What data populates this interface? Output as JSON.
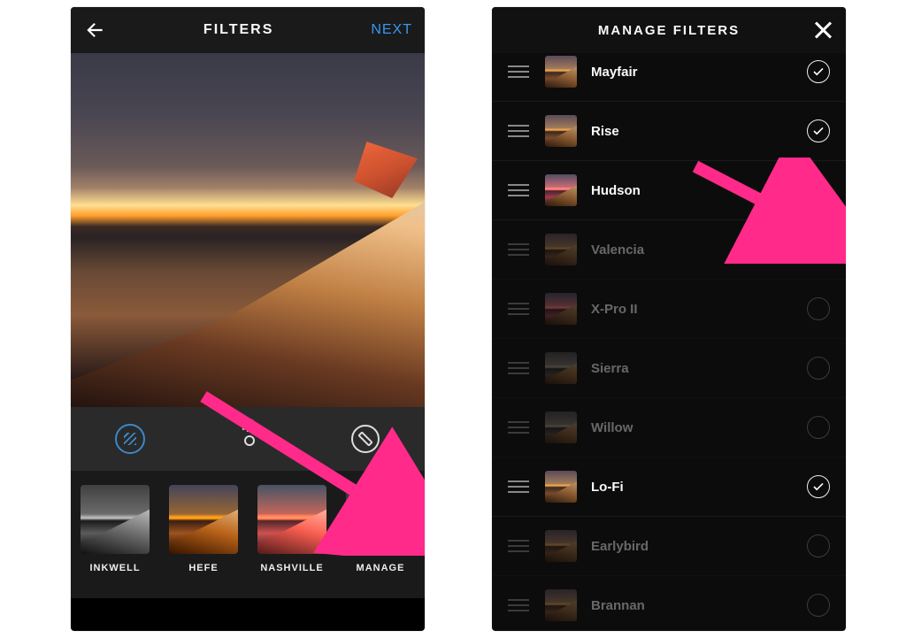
{
  "left": {
    "title": "FILTERS",
    "next": "NEXT",
    "tool_selected": "filter",
    "filters": [
      {
        "id": "inkwell",
        "label": "INKWELL"
      },
      {
        "id": "hefe",
        "label": "HEFE"
      },
      {
        "id": "nashville",
        "label": "NASHVILLE"
      },
      {
        "id": "manage",
        "label": "MANAGE"
      }
    ]
  },
  "right": {
    "title": "MANAGE FILTERS",
    "items": [
      {
        "name": "Mayfair",
        "enabled": true
      },
      {
        "name": "Rise",
        "enabled": true
      },
      {
        "name": "Hudson",
        "enabled": true
      },
      {
        "name": "Valencia",
        "enabled": false
      },
      {
        "name": "X-Pro II",
        "enabled": false
      },
      {
        "name": "Sierra",
        "enabled": false
      },
      {
        "name": "Willow",
        "enabled": false
      },
      {
        "name": "Lo-Fi",
        "enabled": true
      },
      {
        "name": "Earlybird",
        "enabled": false
      },
      {
        "name": "Brannan",
        "enabled": false
      }
    ]
  },
  "annotations": {
    "arrows": [
      {
        "target": "manage-gear"
      },
      {
        "target": "valencia-toggle"
      }
    ],
    "color": "#ff2a8a"
  }
}
